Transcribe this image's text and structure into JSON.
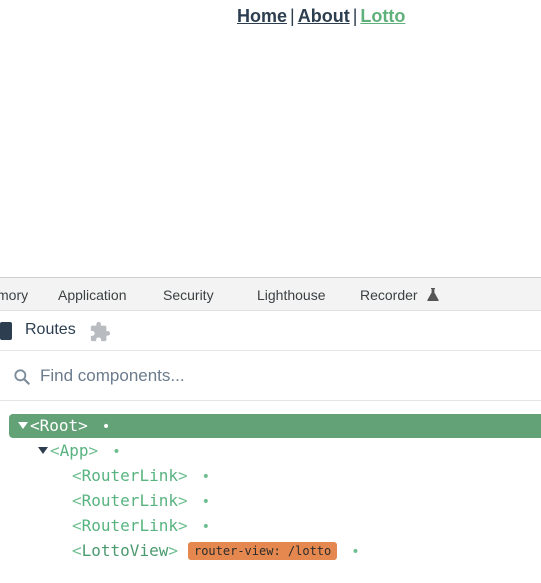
{
  "app_nav": {
    "links": [
      {
        "label": "Home"
      },
      {
        "label": "About"
      },
      {
        "label": "Lotto"
      }
    ],
    "separator": "|"
  },
  "devtools": {
    "tabs": [
      "mory",
      "Application",
      "Security",
      "Lighthouse",
      "Recorder"
    ],
    "vue_panel": {
      "title": "Routes",
      "search_placeholder": "Find components..."
    },
    "tree": {
      "root": {
        "open": "<",
        "name": "Root",
        "close": ">",
        "dot": "•"
      },
      "app": {
        "open": "<",
        "name": "App",
        "close": ">",
        "dot": "•"
      },
      "links": [
        {
          "open": "<",
          "name": "RouterLink",
          "close": ">",
          "dot": "•"
        },
        {
          "open": "<",
          "name": "RouterLink",
          "close": ">",
          "dot": "•"
        },
        {
          "open": "<",
          "name": "RouterLink",
          "close": ">",
          "dot": "•"
        }
      ],
      "view": {
        "open": "<",
        "name": "LottoView",
        "close": ">",
        "badge": "router-view: /lotto",
        "dot": "•"
      }
    }
  },
  "colors": {
    "nav_text": "#2c3e50",
    "active_link": "#5fb07a",
    "selected_row": "#63a277",
    "badge": "#e5884f"
  }
}
